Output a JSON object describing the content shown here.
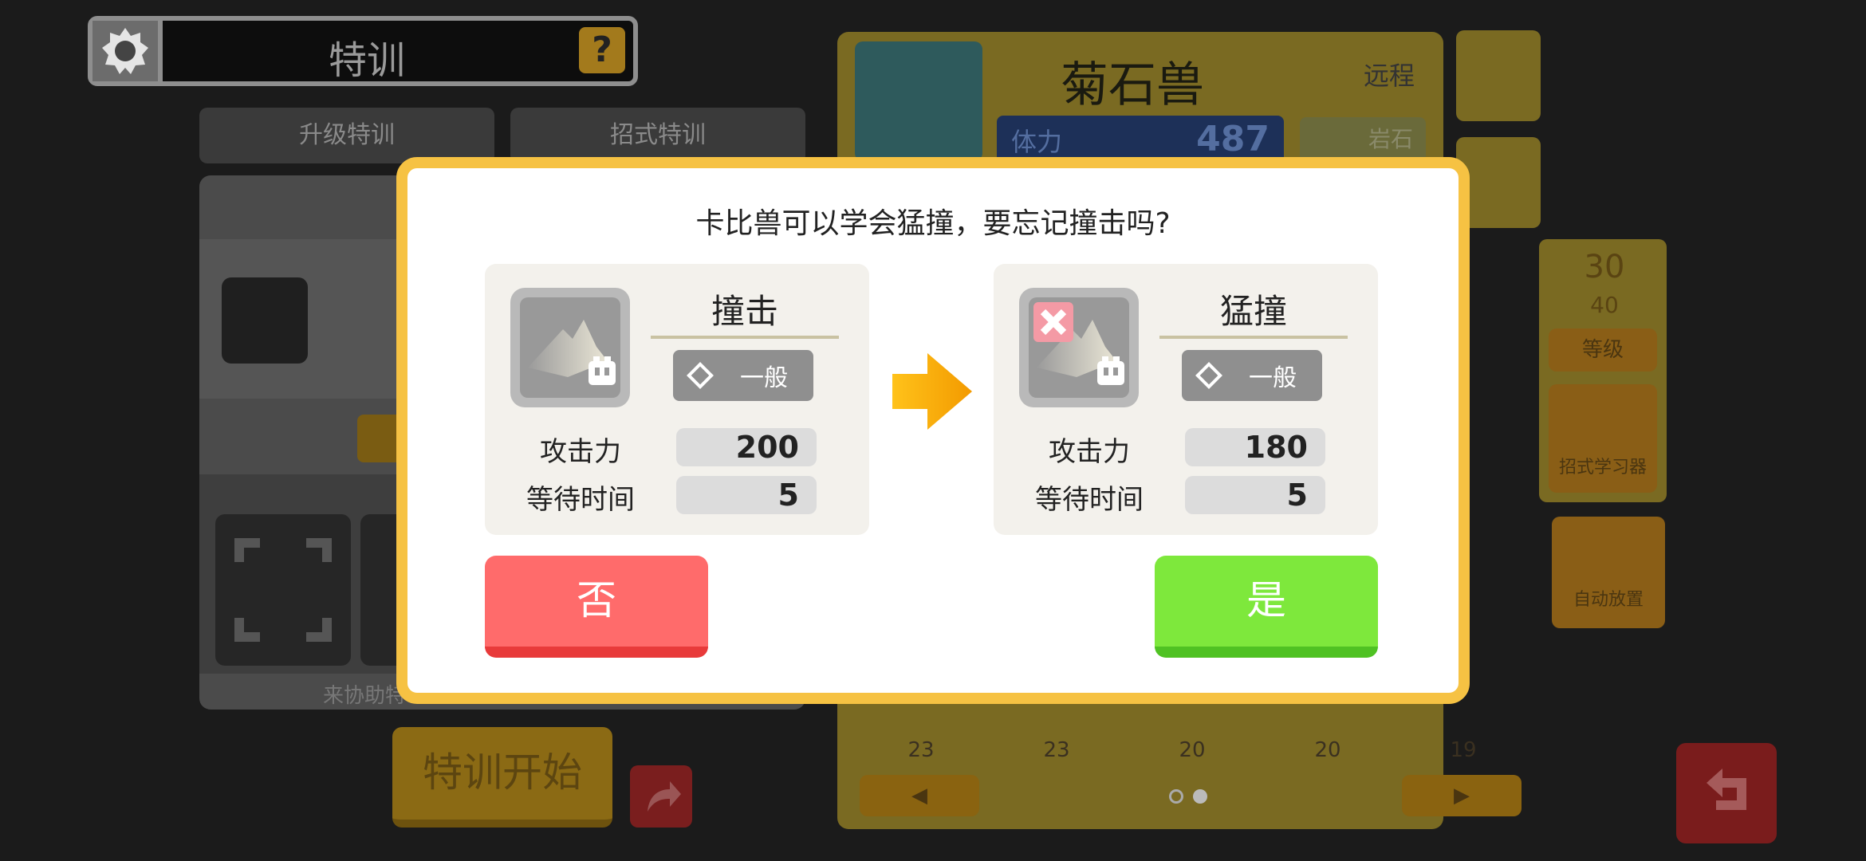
{
  "header": {
    "title": "特训",
    "help_label": "?"
  },
  "tabs": [
    {
      "label": "升级特训"
    },
    {
      "label": "招式特训"
    }
  ],
  "left_panel": {
    "support_label": "来协助特",
    "start_button": "特训开始"
  },
  "pokemon": {
    "name": "菊石兽",
    "range": "远程",
    "hp_label": "体力",
    "hp_value": "487",
    "type": "岩石",
    "level_current": "30",
    "level_max": "40",
    "level_label": "等级",
    "move_learner_label": "招式学习器",
    "auto_place_label": "自动放置"
  },
  "box_levels": [
    "23",
    "23",
    "20",
    "20",
    "19"
  ],
  "pager": {
    "arrow_left": "◀",
    "arrow_right": "▶"
  },
  "dialog": {
    "message": "卡比兽可以学会猛撞，要忘记撞击吗?",
    "current_move": {
      "name": "撞击",
      "type": "一般",
      "attack_label": "攻击力",
      "attack": "200",
      "wait_label": "等待时间",
      "wait": "5"
    },
    "new_move": {
      "name": "猛撞",
      "type": "一般",
      "attack_label": "攻击力",
      "attack": "180",
      "wait_label": "等待时间",
      "wait": "5"
    },
    "no_label": "否",
    "yes_label": "是"
  },
  "colors": {
    "dialog_border": "#f6c243",
    "no_button": "#ff6b6b",
    "yes_button": "#7ee83c",
    "arrow": "#f7b500"
  }
}
